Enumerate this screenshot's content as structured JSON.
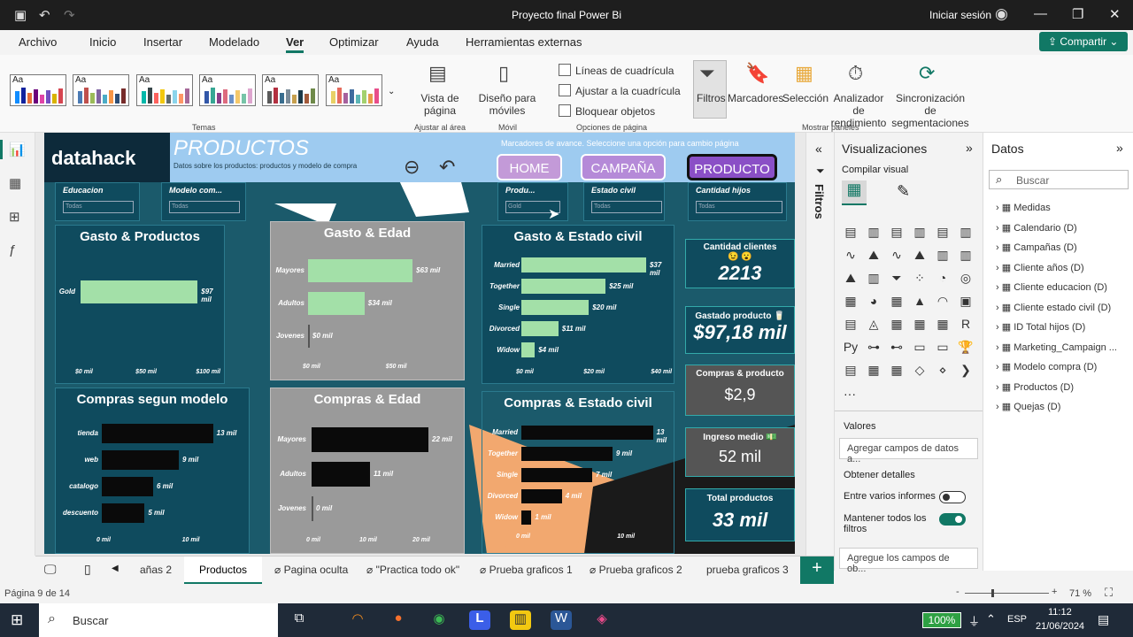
{
  "window": {
    "title": "Proyecto final Power Bi",
    "signin": "Iniciar sesión"
  },
  "menu": [
    "Archivo",
    "Inicio",
    "Insertar",
    "Modelado",
    "Ver",
    "Optimizar",
    "Ayuda",
    "Herramientas externas"
  ],
  "share_label": "Compartir",
  "ribbon": {
    "themes_label": "Temas",
    "page_view": "Vista de página",
    "fit_label": "Ajustar al área",
    "mobile_layout": "Diseño para móviles",
    "mobile_label": "Móvil",
    "gridlines": "Líneas de cuadrícula",
    "snap": "Ajustar a la cuadrícula",
    "lock": "Bloquear objetos",
    "page_options_label": "Opciones de página",
    "filters": "Filtros",
    "bookmarks": "Marcadores",
    "selection": "Selección",
    "perf_analyzer": "Analizador de rendimiento",
    "sync_slicers": "Sincronización de segmentaciones",
    "show_panes_label": "Mostrar paneles"
  },
  "report": {
    "logo": "datahack",
    "title": "PRODUCTOS",
    "subtitle": "Datos sobre los productos: productos y modelo de compra",
    "bookmark_note": "Marcadores de avance. Seleccione una opción para cambio página",
    "nav": [
      "HOME",
      "CAMPAÑA",
      "PRODUCTO"
    ],
    "slicers": [
      {
        "label": "Educacion",
        "value": "Todas"
      },
      {
        "label": "Modelo com...",
        "value": "Todas"
      },
      {
        "label": "Produ...",
        "value": "Gold"
      },
      {
        "label": "Estado civil",
        "value": "Todas"
      },
      {
        "label": "Cantidad hijos",
        "value": "Todas"
      }
    ],
    "kpis": [
      {
        "label": "Cantidad clientes 😉 😮",
        "value": "2213"
      },
      {
        "label": "Gastado producto 🥛",
        "value": "$97,18 mil"
      },
      {
        "label": "Compras & producto",
        "value": "$2,9"
      },
      {
        "label": "Ingreso medio 💵",
        "value": "52 mil"
      },
      {
        "label": "Total productos",
        "value": "33 mil"
      }
    ]
  },
  "chart_data": [
    {
      "type": "bar",
      "title": "Gasto & Productos",
      "categories": [
        "Gold"
      ],
      "values": [
        97
      ],
      "value_labels": [
        "$97 mil"
      ],
      "ticks": [
        "$0 mil",
        "$50 mil",
        "$100 mil"
      ],
      "xlim": [
        0,
        110
      ]
    },
    {
      "type": "bar",
      "title": "Gasto & Edad",
      "categories": [
        "Mayores",
        "Adultos",
        "Jovenes"
      ],
      "values": [
        63,
        34,
        0
      ],
      "value_labels": [
        "$63 mil",
        "$34 mil",
        "$0 mil"
      ],
      "ticks": [
        "$0 mil",
        "$50 mil"
      ],
      "xlim": [
        0,
        80
      ]
    },
    {
      "type": "bar",
      "title": "Gasto & Estado civil",
      "categories": [
        "Married",
        "Together",
        "Single",
        "Divorced",
        "Widow"
      ],
      "values": [
        37,
        25,
        20,
        11,
        4
      ],
      "value_labels": [
        "$37 mil",
        "$25 mil",
        "$20 mil",
        "$11 mil",
        "$4 mil"
      ],
      "ticks": [
        "$0 mil",
        "$20 mil",
        "$40 mil"
      ],
      "xlim": [
        0,
        42
      ]
    },
    {
      "type": "bar",
      "title": "Compras segun modelo",
      "categories": [
        "tienda",
        "web",
        "catalogo",
        "descuento"
      ],
      "values": [
        13,
        9,
        6,
        5
      ],
      "value_labels": [
        "13 mil",
        "9 mil",
        "6 mil",
        "5 mil"
      ],
      "ticks": [
        "0 mil",
        "10 mil"
      ],
      "xlim": [
        0,
        15
      ]
    },
    {
      "type": "bar",
      "title": "Compras & Edad",
      "categories": [
        "Mayores",
        "Adultos",
        "Jovenes"
      ],
      "values": [
        22,
        11,
        0
      ],
      "value_labels": [
        "22 mil",
        "11 mil",
        "0 mil"
      ],
      "ticks": [
        "0 mil",
        "10 mil",
        "20 mil"
      ],
      "xlim": [
        0,
        25
      ]
    },
    {
      "type": "bar",
      "title": "Compras & Estado civil",
      "categories": [
        "Married",
        "Together",
        "Single",
        "Divorced",
        "Widow"
      ],
      "values": [
        13,
        9,
        7,
        4,
        1
      ],
      "value_labels": [
        "13 mil",
        "9 mil",
        "7 mil",
        "4 mil",
        "1 mil"
      ],
      "ticks": [
        "0 mil",
        "10 mil"
      ],
      "xlim": [
        0,
        14
      ]
    }
  ],
  "filters_pane": "Filtros",
  "viz_pane": {
    "title": "Visualizaciones",
    "build": "Compilar visual",
    "values": "Valores",
    "add_fields": "Agregar campos de datos a...",
    "details": "Obtener detalles",
    "cross_report": "Entre varios informes",
    "keep_filters": "Mantener todos los filtros",
    "add_fields2": "Agregue los campos de ob..."
  },
  "data_pane": {
    "title": "Datos",
    "search_placeholder": "Buscar",
    "fields": [
      "Medidas",
      "Calendario (D)",
      "Campañas (D)",
      "Cliente años (D)",
      "Cliente educacion (D)",
      "Cliente estado civil (D)",
      "ID Total hijos (D)",
      "Marketing_Campaign ...",
      "Modelo compra (D)",
      "Productos (D)",
      "Quejas (D)"
    ]
  },
  "tabs": [
    "añas 2",
    "Productos",
    "Pagina oculta",
    "\"Practica todo ok\"",
    "Prueba graficos 1",
    "Prueba graficos 2",
    "prueba graficos 3"
  ],
  "status": {
    "page": "Página 9 de 14",
    "zoom": "71 %"
  },
  "taskbar": {
    "search": "Buscar",
    "battery": "100%",
    "lang": "ESP",
    "time": "11:12",
    "date": "21/06/2024"
  }
}
